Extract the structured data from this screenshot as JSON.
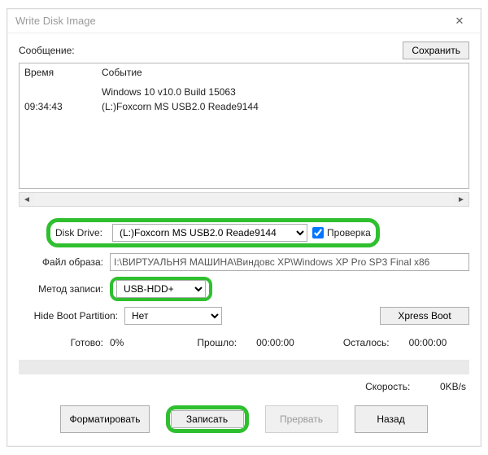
{
  "window": {
    "title": "Write Disk Image"
  },
  "labels": {
    "message": "Сообщение:",
    "disk_drive": "Disk Drive:",
    "image_file": "Файл образа:",
    "write_method": "Метод записи:",
    "hide_boot_partition": "Hide Boot Partition:"
  },
  "buttons": {
    "save": "Сохранить",
    "xpress_boot": "Xpress Boot",
    "format": "Форматировать",
    "write": "Записать",
    "abort": "Прервать",
    "back": "Назад"
  },
  "log": {
    "headers": {
      "time": "Время",
      "event": "Событие"
    },
    "rows": [
      {
        "time": "",
        "event": "Windows 10 v10.0 Build 15063"
      },
      {
        "time": "09:34:43",
        "event": "(L:)Foxcorn MS  USB2.0 Reade9144"
      }
    ]
  },
  "fields": {
    "disk_drive": {
      "value": "(L:)Foxcorn MS  USB2.0 Reade9144"
    },
    "verify": {
      "label": "Проверка",
      "checked": true
    },
    "image_file": {
      "value": "I:\\ВИРТУАЛЬНЯ МАШИНА\\Виндовс XP\\Windows XP Pro SP3 Final x86"
    },
    "write_method": {
      "value": "USB-HDD+"
    },
    "hide_boot_partition": {
      "value": "Нет"
    }
  },
  "progress": {
    "ready_label": "Готово:",
    "percent": "0%",
    "elapsed_label": "Прошло:",
    "elapsed_value": "00:00:00",
    "remaining_label": "Осталось:",
    "remaining_value": "00:00:00",
    "speed_label": "Скорость:",
    "speed_value": "0KB/s"
  },
  "colors": {
    "highlight": "#2fbf2f"
  }
}
